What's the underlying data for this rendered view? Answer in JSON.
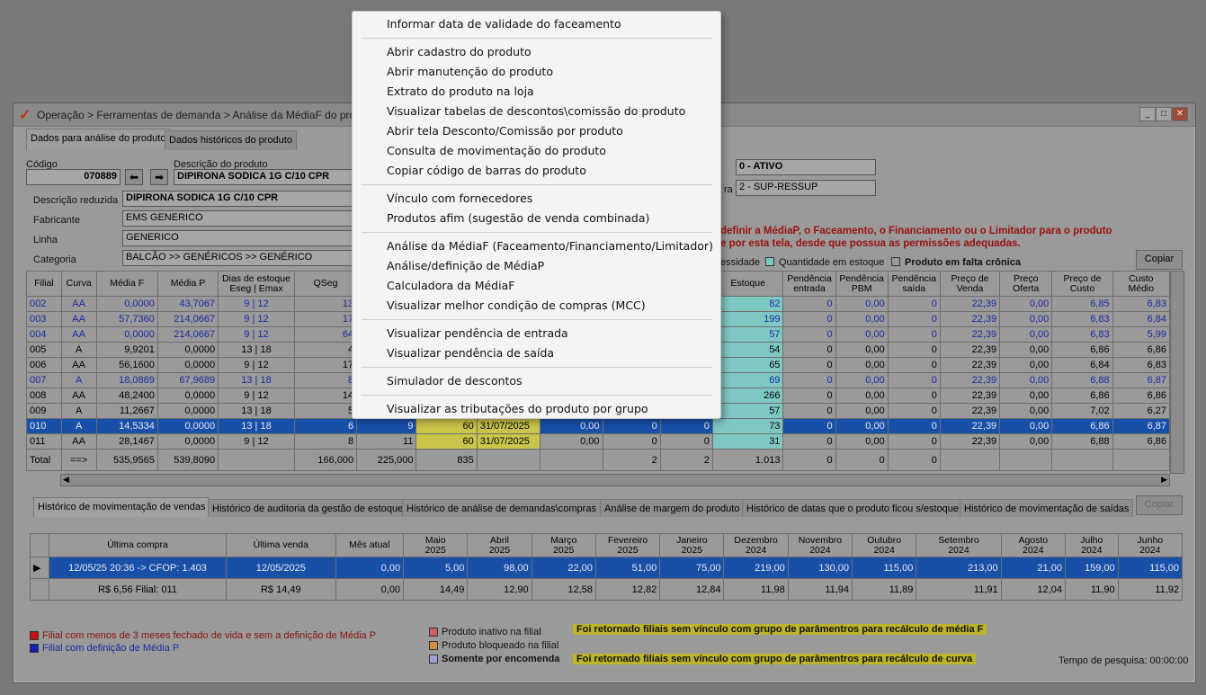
{
  "window": {
    "title": "Operação > Ferramentas de demanda > Análise da MédiaF do produto",
    "minimize": "_",
    "maximize": "□",
    "close": "✕"
  },
  "tabs": [
    "Dados para análise do produto",
    "Dados históricos do produto"
  ],
  "product": {
    "code_label": "Código",
    "code": "070889",
    "desc_label": "Descrição do produto",
    "desc": "DIPIRONA SODICA 1G C/10 CPR",
    "short_desc_label": "Descrição reduzida",
    "short_desc": "DIPIRONA SODICA 1G C/10 CPR",
    "manufacturer_label": "Fabricante",
    "manufacturer": "EMS GENERICO",
    "line_label": "Linha",
    "line": "GENERICO",
    "category_label": "Categoria",
    "category": "BALCÃO >> GENÉRICOS >> GENÉRICO",
    "status": "0 - ATIVO",
    "type_label": "ra",
    "type": "2 - SUP-RESSUP"
  },
  "warning": {
    "line1": "definir a MédiaP, o Faceamento, o Financiamento ou o Limitador para o produto",
    "line2": "e por esta tela, desde que possua as permissões adequadas."
  },
  "legend_top": {
    "item1": "essidade",
    "item2": "Quantidade em estoque",
    "item3": "Produto em falta crônica",
    "copy": "Copiar"
  },
  "table": {
    "headers_left": [
      "Filial",
      "Curva",
      "Média F",
      "Média P",
      "Dias de estoque\nEseg | Emax",
      "QSeg"
    ],
    "headers_right": [
      "Estoque",
      "Pendência\nentrada",
      "Pendência\nPBM",
      "Pendência\nsaída",
      "Preço de\nVenda",
      "Preço\nOferta",
      "Preço de\nCusto",
      "Custo\nMédio"
    ],
    "rows": [
      {
        "filial": "002",
        "curva": "AA",
        "mf": "0,0000",
        "mp": "43,7067",
        "eseg": "9",
        "emax": "12",
        "qseg": "13",
        "estoque": "82",
        "pe": "0",
        "pbm": "0,00",
        "ps": "0",
        "pv": "22,39",
        "po": "0,00",
        "pc": "6,85",
        "cm": "6,83",
        "blue": true
      },
      {
        "filial": "003",
        "curva": "AA",
        "mf": "57,7360",
        "mp": "214,0667",
        "eseg": "9",
        "emax": "12",
        "qseg": "17",
        "estoque": "199",
        "pe": "0",
        "pbm": "0,00",
        "ps": "0",
        "pv": "22,39",
        "po": "0,00",
        "pc": "6,83",
        "cm": "6,84",
        "blue": true
      },
      {
        "filial": "004",
        "curva": "AA",
        "mf": "0,0000",
        "mp": "214,0667",
        "eseg": "9",
        "emax": "12",
        "qseg": "64",
        "estoque": "57",
        "pe": "0",
        "pbm": "0,00",
        "ps": "0",
        "pv": "22,39",
        "po": "0,00",
        "pc": "6,83",
        "cm": "5,99",
        "blue": true
      },
      {
        "filial": "005",
        "curva": "A",
        "mf": "9,9201",
        "mp": "0,0000",
        "eseg": "13",
        "emax": "18",
        "qseg": "4",
        "estoque": "54",
        "pe": "0",
        "pbm": "0,00",
        "ps": "0",
        "pv": "22,39",
        "po": "0,00",
        "pc": "6,86",
        "cm": "6,86",
        "blue": false
      },
      {
        "filial": "006",
        "curva": "AA",
        "mf": "56,1600",
        "mp": "0,0000",
        "eseg": "9",
        "emax": "12",
        "qseg": "17",
        "estoque": "65",
        "pe": "0",
        "pbm": "0,00",
        "ps": "0",
        "pv": "22,39",
        "po": "0,00",
        "pc": "6,84",
        "cm": "6,83",
        "blue": false
      },
      {
        "filial": "007",
        "curva": "A",
        "mf": "18,0869",
        "mp": "67,9689",
        "eseg": "13",
        "emax": "18",
        "qseg": "8",
        "estoque": "69",
        "pe": "0",
        "pbm": "0,00",
        "ps": "0",
        "pv": "22,39",
        "po": "0,00",
        "pc": "6,88",
        "cm": "6,87",
        "blue": true
      },
      {
        "filial": "008",
        "curva": "AA",
        "mf": "48,2400",
        "mp": "0,0000",
        "eseg": "9",
        "emax": "12",
        "qseg": "14",
        "estoque": "266",
        "pe": "0",
        "pbm": "0,00",
        "ps": "0",
        "pv": "22,39",
        "po": "0,00",
        "pc": "6,86",
        "cm": "6,86",
        "blue": false
      },
      {
        "filial": "009",
        "curva": "A",
        "mf": "11,2667",
        "mp": "0,0000",
        "eseg": "13",
        "emax": "18",
        "qseg": "5",
        "estoque": "57",
        "pe": "0",
        "pbm": "0,00",
        "ps": "0",
        "pv": "22,39",
        "po": "0,00",
        "pc": "7,02",
        "cm": "6,27",
        "blue": false
      }
    ],
    "sel_row": {
      "filial": "010",
      "curva": "A",
      "mf": "14,5334",
      "mp": "0,0000",
      "eseg": "13",
      "emax": "18",
      "qseg": "6",
      "c7": "9",
      "c8": "60",
      "c9": "31/07/2025",
      "c10": "0,00",
      "c11": "0",
      "c12": "0",
      "estoque": "73",
      "pe": "0",
      "pbm": "0,00",
      "ps": "0",
      "pv": "22,39",
      "po": "0,00",
      "pc": "6,86",
      "cm": "6,87"
    },
    "row11": {
      "filial": "011",
      "curva": "AA",
      "mf": "28,1467",
      "mp": "0,0000",
      "eseg": "9",
      "emax": "12",
      "qseg": "8",
      "c7": "11",
      "c8": "60",
      "c9": "31/07/2025",
      "c10": "0,00",
      "c11": "0",
      "c12": "0",
      "estoque": "31",
      "pe": "0",
      "pbm": "0,00",
      "ps": "0",
      "pv": "22,39",
      "po": "0,00",
      "pc": "6,88",
      "cm": "6,86"
    },
    "total": {
      "label": "Total",
      "curva": "==>",
      "mf": "535,9565",
      "mp": "539,8090",
      "qseg": "166,000",
      "c7": "225,000",
      "c8": "835",
      "c11": "2",
      "c12": "2",
      "estoque": "1.013",
      "pe": "0",
      "pbm": "0",
      "ps": "0"
    }
  },
  "hist_tabs": [
    "Histórico de movimentação de vendas",
    "Histórico de auditoria da gestão de estoque",
    "Histórico de análise de demandas\\compras",
    "Análise de margem do produto",
    "Histórico de datas que o produto ficou s/estoque",
    "Histórico de movimentação de saídas"
  ],
  "hist_copy": "Copiar",
  "hist": {
    "headers": [
      "Última compra",
      "Última venda",
      "Mês atual",
      "Maio\n2025",
      "Abril\n2025",
      "Março\n2025",
      "Fevereiro\n2025",
      "Janeiro\n2025",
      "Dezembro\n2024",
      "Novembro\n2024",
      "Outubro\n2024",
      "Setembro\n2024",
      "Agosto\n2024",
      "Julho\n2024",
      "Junho\n2024"
    ],
    "row1": [
      "12/05/25 20:36 -> CFOP: 1.403",
      "12/05/2025",
      "0,00",
      "5,00",
      "98,00",
      "22,00",
      "51,00",
      "75,00",
      "219,00",
      "130,00",
      "115,00",
      "213,00",
      "21,00",
      "159,00",
      "115,00"
    ],
    "row2": [
      "R$ 6,56 Filial: 011",
      "R$ 14,49",
      "0,00",
      "14,49",
      "12,90",
      "12,58",
      "12,82",
      "12,84",
      "11,98",
      "11,94",
      "11,89",
      "11,91",
      "12,04",
      "11,90",
      "11,92"
    ]
  },
  "footer": {
    "red_legend": "Filial com menos de 3 meses fechado de vida e sem a definição de Média P",
    "blue_legend": "Filial com definição de Média P",
    "inactive": "Produto inativo na filial",
    "blocked": "Produto bloqueado na filial",
    "order_only": "Somente por encomenda",
    "msg1": "Foi retornado filiais sem vínculo com grupo de parâmentros para recálculo de média F",
    "msg2": "Foi retornado filiais sem vínculo com grupo de parâmentros para recálculo de curva",
    "search_time": "Tempo de pesquisa: 00:00:00"
  },
  "menu": {
    "g1": [
      "Informar data de validade do faceamento"
    ],
    "g2": [
      "Abrir cadastro do produto",
      "Abrir manutenção do produto",
      "Extrato do produto na loja",
      "Visualizar tabelas de descontos\\comissão do produto",
      "Abrir tela Desconto/Comissão por produto",
      "Consulta de movimentação do produto",
      "Copiar código de barras do produto"
    ],
    "g3": [
      "Vínculo com fornecedores",
      "Produtos afim (sugestão de venda combinada)"
    ],
    "g4": [
      "Análise da MédiaF (Faceamento/Financiamento/Limitador)",
      "Análise/definição de MédiaP",
      "Calculadora da MédiaF",
      "Visualizar melhor condição de compras (MCC)"
    ],
    "g5": [
      "Visualizar pendência de entrada",
      "Visualizar pendência de saída"
    ],
    "g6": [
      "Simulador de descontos"
    ],
    "g7": [
      "Visualizar as tributações do produto por grupo"
    ]
  }
}
